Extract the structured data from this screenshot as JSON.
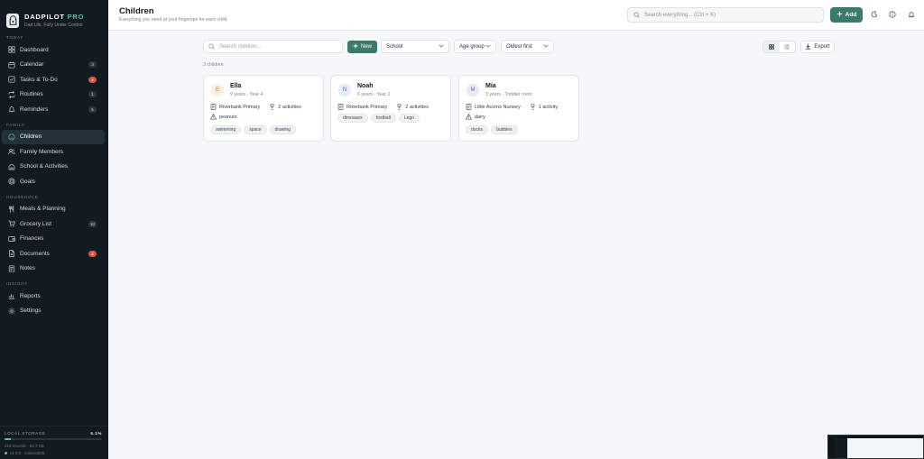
{
  "app": {
    "name": "DADPILOT",
    "name_suffix": "PRO",
    "tagline": "Dad Life. Fully Under Control"
  },
  "sidebar": {
    "sections": [
      {
        "label": "TODAY",
        "items": [
          {
            "label": "Dashboard",
            "icon": "dashboard-icon",
            "badge": null
          },
          {
            "label": "Calendar",
            "icon": "calendar-icon",
            "badge": "3"
          },
          {
            "label": "Tasks & To-Do",
            "icon": "checkbox-icon",
            "badge": "2",
            "badge_color": "#d9534f"
          },
          {
            "label": "Routines",
            "icon": "repeat-icon",
            "badge": "1"
          },
          {
            "label": "Reminders",
            "icon": "bell-icon",
            "badge": "5"
          }
        ]
      },
      {
        "label": "FAMILY",
        "items": [
          {
            "label": "Children",
            "icon": "smiley-icon",
            "badge": null,
            "active": true
          },
          {
            "label": "Family Members",
            "icon": "users-icon",
            "badge": null
          },
          {
            "label": "School & Activities",
            "icon": "school-icon",
            "badge": null
          },
          {
            "label": "Goals",
            "icon": "target-icon",
            "badge": null
          }
        ]
      },
      {
        "label": "HOUSEHOLD",
        "items": [
          {
            "label": "Meals & Planning",
            "icon": "utensils-icon",
            "badge": null
          },
          {
            "label": "Grocery List",
            "icon": "cart-icon",
            "badge": "10"
          },
          {
            "label": "Finances",
            "icon": "wallet-icon",
            "badge": null
          },
          {
            "label": "Documents",
            "icon": "document-icon",
            "badge": "2",
            "badge_color": "#d9534f"
          },
          {
            "label": "Notes",
            "icon": "note-icon",
            "badge": null
          }
        ]
      },
      {
        "label": "INSIGHT",
        "items": [
          {
            "label": "Reports",
            "icon": "chart-icon",
            "badge": null
          },
          {
            "label": "Settings",
            "icon": "gear-icon",
            "badge": null
          }
        ]
      }
    ],
    "storage": {
      "label": "LOCAL STORAGE",
      "percent_text": "6.1%",
      "percent": 6.1,
      "records": "218 records · 64.7 KB",
      "version": "v1.0.0 · IndexedDB"
    }
  },
  "header": {
    "title": "Children",
    "subtitle": "Everything you need at your fingertips for each child",
    "search_placeholder": "Search everything...  (Ctrl + K)",
    "add_label": "Add"
  },
  "toolbar": {
    "search_placeholder": "Search children...",
    "new_label": "New",
    "filters": [
      "School",
      "Age group",
      "Oldest first"
    ],
    "export_label": "Export",
    "count_text": "3 children"
  },
  "children": [
    {
      "initial": "E",
      "name": "Ella",
      "subtitle": "9 years · Year 4",
      "school": "Riverbank Primary",
      "activities": "2 activities",
      "allergy": "peanuts",
      "tags": [
        "swimming",
        "space",
        "drawing"
      ],
      "avatar_bg": "#fbeee0",
      "avatar_fg": "#b9803f"
    },
    {
      "initial": "N",
      "name": "Noah",
      "subtitle": "6 years · Year 1",
      "school": "Riverbank Primary",
      "activities": "2 activities",
      "allergy": null,
      "tags": [
        "dinosaurs",
        "football",
        "Lego"
      ],
      "avatar_bg": "#e4ecf8",
      "avatar_fg": "#5270a3"
    },
    {
      "initial": "M",
      "name": "Mia",
      "subtitle": "3 years · Toddler room",
      "school": "Little Acorns Nursery",
      "activities": "1 activity",
      "allergy": "dairy",
      "tags": [
        "ducks",
        "bubbles"
      ],
      "avatar_bg": "#ece6f6",
      "avatar_fg": "#7458a4"
    }
  ],
  "colors": {
    "accent": "#3c7a6d",
    "sidebar_bg": "#121b20",
    "alert": "#d9534f"
  }
}
